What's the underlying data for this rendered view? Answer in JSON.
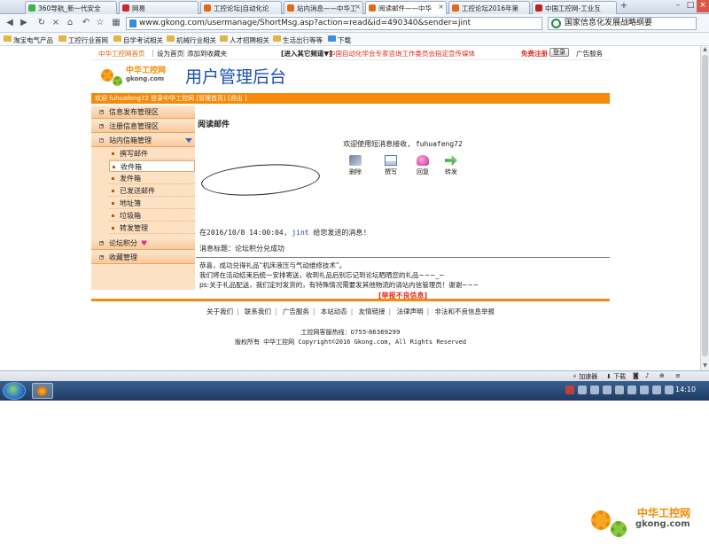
{
  "browser": {
    "tabs": [
      {
        "label": "360导航_新一代安全"
      },
      {
        "label": "网易"
      },
      {
        "label": "工控论坛|自动化论"
      },
      {
        "label": "站内消息——中华工"
      },
      {
        "label": "阅读邮件——中华"
      },
      {
        "label": "工控论坛2016年第"
      },
      {
        "label": "中国工控网-工业互"
      }
    ],
    "new_tab": "+",
    "url": "www.gkong.com/usermanage/ShortMsg.asp?action=read&id=490340&sender=jint",
    "search_text": "国家信息化发展战略纲要",
    "bookmarks": [
      "淘宝电气产品",
      "工控行业首网",
      "自学考试相关",
      "机械行业相关",
      "人才招聘相关",
      "生活出行等等",
      "下载"
    ]
  },
  "site": {
    "top_links": [
      "中华工控网首页",
      "设为首页",
      "添加到收藏夹"
    ],
    "channel": "[进入其它频道▼]",
    "notice": "中国自动化学会专家咨询工作委员会指定宣传媒体",
    "free_register": "免费注册",
    "login": "登录",
    "ad_service": "广告服务",
    "logo_cn": "中华工控网",
    "logo_url": "gkong.com",
    "admin_title": "用户管理后台",
    "welcome_bar": "欢迎 fuhuafeng72 登录中华工控网 [管理首页] [退出 ]"
  },
  "sidebar": {
    "sections": [
      {
        "label": "信息发布管理区"
      },
      {
        "label": "注册信息管理区"
      },
      {
        "label": "站内信箱管理"
      },
      {
        "label": "论坛积分"
      },
      {
        "label": "收藏管理"
      }
    ],
    "mailbox_items": [
      {
        "label": "撰写邮件"
      },
      {
        "label": "收件箱"
      },
      {
        "label": "发件箱"
      },
      {
        "label": "已发送邮件"
      },
      {
        "label": "地址簿"
      },
      {
        "label": "垃圾箱"
      },
      {
        "label": "转发管理"
      }
    ]
  },
  "mail": {
    "page_title": "阅读邮件",
    "welcome": "欢迎使用短消息接收, fuhuafeng72",
    "actions": [
      "删除",
      "撰写",
      "回复",
      "转发"
    ],
    "meta_prefix": "在2016/10/8 14:00:04, ",
    "sender": "jint",
    "meta_suffix": " 给您发送的消息!",
    "subject_line": "消息标题：论坛积分兑成功",
    "body_lines": [
      "恭喜，成功兑得礼品“机床液压与气动维修技术”。",
      "我们将在活动结束后统一安排寄送，收到礼品后别忘记到论坛晒晒您的礼品~~~_~",
      "ps:关于礼品配送，我们定时发货的，有特殊情况需要发其他物流的请站内信管理员！谢谢~~~"
    ],
    "report": "[举报不良信息]"
  },
  "footer": {
    "links": [
      "关于我们",
      "联系我们",
      "广告服务",
      "本站动态",
      "友情链接",
      "法律声明",
      "非法和不良信息举报"
    ],
    "hotline": "工控网客服热线：0755-86369299",
    "copyright": "版权所有 中华工控网 Copyright©2016 Gkong.com, All Rights Reserved"
  },
  "statusbar": {
    "speed": "加速器",
    "download": "下载"
  },
  "taskbar": {
    "clock": "14:10"
  },
  "watermark": {
    "cn": "中华工控网",
    "url": "gkong.com"
  }
}
